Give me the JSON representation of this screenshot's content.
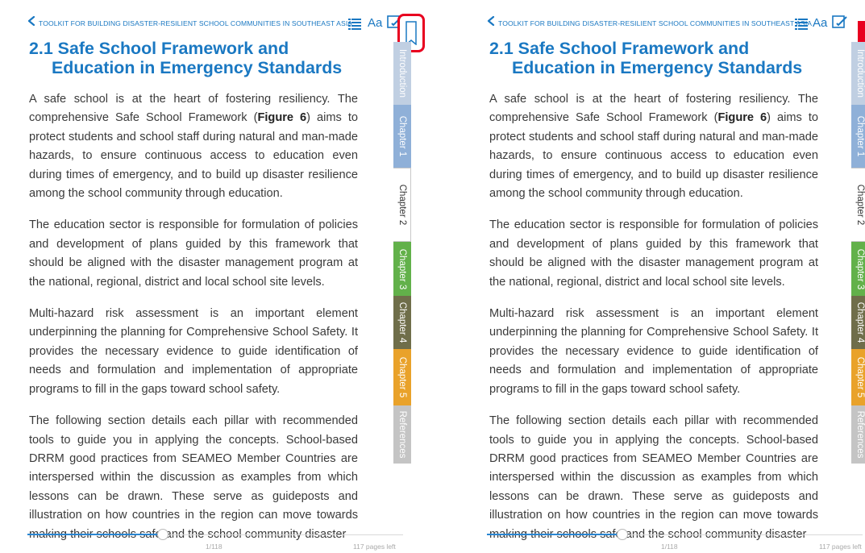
{
  "header": {
    "title": "TOOLKIT FOR BUILDING DISASTER-RESILIENT SCHOOL COMMUNITIES IN SOUTHEAST ASIA",
    "font_button": "Aa"
  },
  "section": {
    "title": "2.1 Safe School Framework and Education in Emergency Standards"
  },
  "paragraphs": {
    "p1_before": "A safe school is at the heart of fostering resiliency. The comprehensive Safe School Framework (",
    "p1_bold": "Figure 6",
    "p1_after": ") aims to protect students and school staff during natural and man-made hazards, to ensure continuous access to education even during times of emergency, and to build up disaster resilience among the school community through education.",
    "p2": "The education sector is responsible for formulation of policies and development of plans guided by this framework that should be aligned with the disaster management program at the national, regional, district and local school site levels.",
    "p3": "Multi-hazard risk assessment is an important element underpinning the planning for Comprehensive School Safety. It provides the necessary evidence to guide identification of needs and formulation and implementation of appropriate programs to fill in the gaps toward school safety.",
    "p4": "The following section details each pillar with recommended tools to guide you in applying the concepts. School-based DRRM good practices from SEAMEO Member Countries are interspersed within the discussion as examples from which lessons can be drawn. These serve as guideposts and illustration on how countries in the region can move towards making their schools safe and the school community disaster"
  },
  "tabs": [
    {
      "label": "Introduction",
      "color": "#c0cfe2"
    },
    {
      "label": "Chapter 1",
      "color": "#8fb0d8"
    },
    {
      "label": "Chapter 2",
      "color": "#ffffff",
      "active": true
    },
    {
      "label": "Chapter 3",
      "color": "#62b14a"
    },
    {
      "label": "Chapter 4",
      "color": "#6f6e4a"
    },
    {
      "label": "Chapter 5",
      "color": "#e9a22a"
    },
    {
      "label": "References",
      "color": "#c4c4c4"
    }
  ],
  "footer": {
    "page_number": "1/118",
    "pages_left": "117 pages left",
    "progress": 0.36
  },
  "colors": {
    "accent": "#1a78c2",
    "bookmark_highlight": "#e8001f"
  }
}
